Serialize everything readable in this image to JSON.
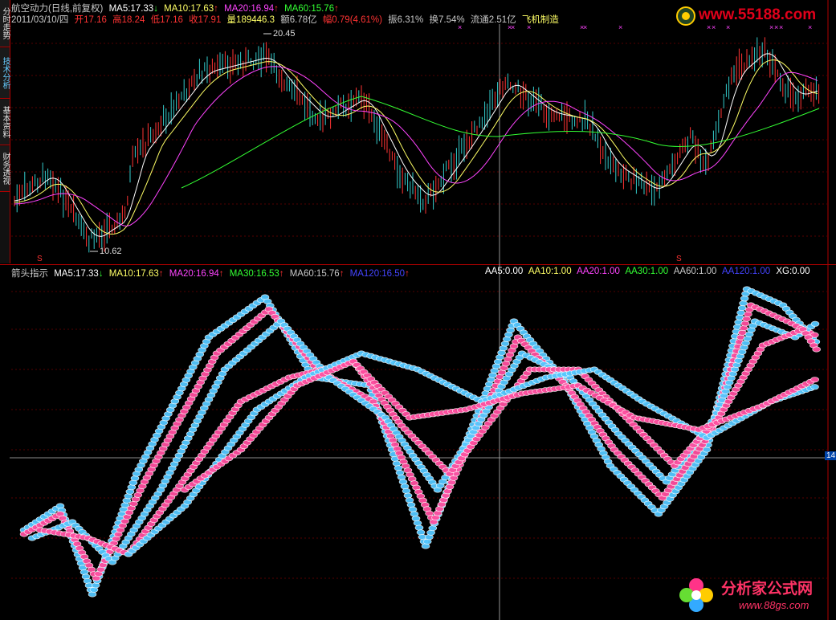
{
  "sidebar": {
    "tabs": [
      "分时走势",
      "技术分析",
      "基本资料",
      "财务透视"
    ]
  },
  "upper": {
    "title": "航空动力(日线,前复权)",
    "ma": [
      {
        "label": "MA5:17.33",
        "arrow": "↓",
        "color": "#ffffff"
      },
      {
        "label": "MA10:17.63",
        "arrow": "↑",
        "color": "#ffff66"
      },
      {
        "label": "MA20:16.94",
        "arrow": "↑",
        "color": "#ff44ff"
      },
      {
        "label": "MA60:15.76",
        "arrow": "↑",
        "color": "#33ff33"
      }
    ],
    "date": "2011/03/10/四",
    "open": "开17.16",
    "high": "高18.24",
    "low": "低17.16",
    "close": "收17.91",
    "volume": "量189446.3",
    "amount": "额6.78亿",
    "range": "幅0.79(4.61%)",
    "amplitude": "振6.31%",
    "turnover": "换7.54%",
    "float": "流通2.51亿",
    "sector": "飞机制造",
    "high_mark": "20.45",
    "low_mark": "10.62",
    "signal_mark": "S"
  },
  "lower": {
    "title": "箭头指示",
    "ma": [
      {
        "label": "MA5:17.33",
        "arrow": "↓",
        "color": "#ffffff"
      },
      {
        "label": "MA10:17.63",
        "arrow": "↑",
        "color": "#ffff66"
      },
      {
        "label": "MA20:16.94",
        "arrow": "↑",
        "color": "#ff44ff"
      },
      {
        "label": "MA30:16.53",
        "arrow": "↑",
        "color": "#33ff33"
      },
      {
        "label": "MA60:15.76",
        "arrow": "↑",
        "color": "#c8c8c8"
      },
      {
        "label": "MA120:16.50",
        "arrow": "↑",
        "color": "#4444ff"
      }
    ],
    "aa": [
      {
        "label": "AA5:0.00",
        "color": "#ffffff"
      },
      {
        "label": "AA10:1.00",
        "color": "#ffff66"
      },
      {
        "label": "AA20:1.00",
        "color": "#ff44ff"
      },
      {
        "label": "AA30:1.00",
        "color": "#33ff33"
      },
      {
        "label": "AA60:1.00",
        "color": "#c8c8c8"
      },
      {
        "label": "AA120:1.00",
        "color": "#4444ff"
      },
      {
        "label": "XG:0.00",
        "color": "#ffffff"
      }
    ],
    "axis_value": "14"
  },
  "watermarks": {
    "top": "www.55188.com",
    "bottom_cn": "分析家公式网",
    "bottom_url": "www.88gs.com"
  },
  "colors": {
    "up": "#ff3333",
    "down": "#33cccc",
    "pink": "#ff4fa0",
    "blue": "#55c8ff"
  }
}
